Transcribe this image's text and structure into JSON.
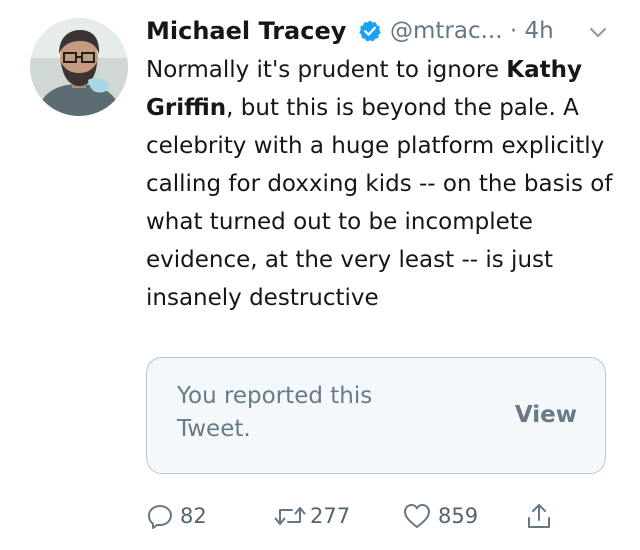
{
  "tweet": {
    "author_name": "Michael Tracey",
    "handle": "@mtrac...",
    "time": "· 4h",
    "text_before_bold": "Normally it's prudent to ignore ",
    "text_bold": "Kathy Griffin",
    "text_after_bold": ", but this is beyond the pale. A celebrity with a huge platform explicitly calling for doxxing kids -- on the basis of what turned out to be incomplete evidence, at the very least -- is just insanely destructive"
  },
  "notice": {
    "message": "You reported this Tweet.",
    "action_label": "View"
  },
  "actions": {
    "replies": "82",
    "retweets": "277",
    "likes": "859"
  },
  "icons": {
    "verified": "verified-badge-icon",
    "menu": "chevron-down-icon",
    "reply": "reply-icon",
    "retweet": "retweet-icon",
    "like": "heart-icon",
    "share": "share-icon"
  },
  "colors": {
    "text": "#14171a",
    "secondary": "#657786",
    "verified": "#1da1f2",
    "notice_bg": "#f5f8fa",
    "notice_border": "#b7c9d6"
  }
}
